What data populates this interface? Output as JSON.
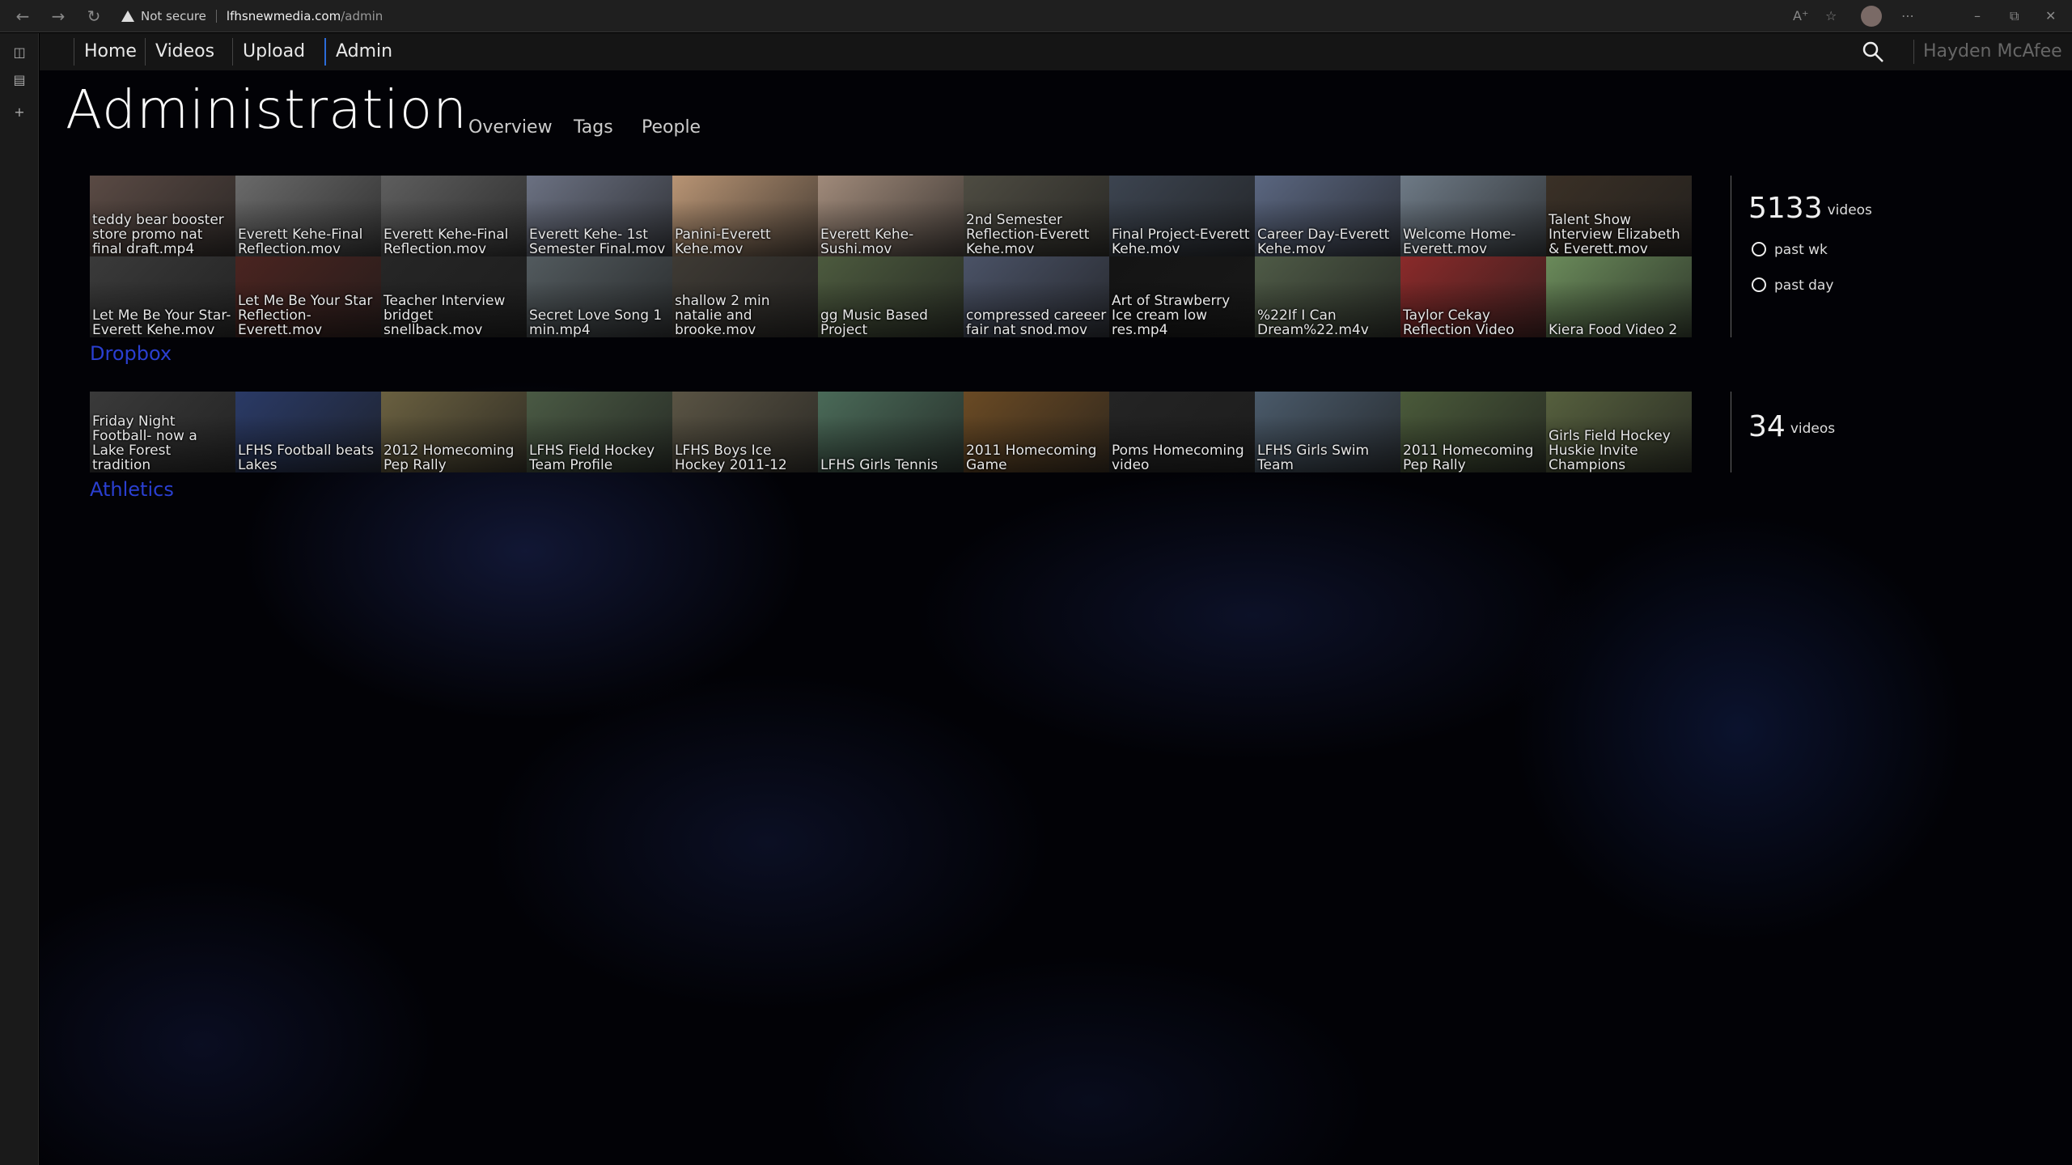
{
  "browser": {
    "security_label": "Not secure",
    "url_host": "lfhsnewmedia.com",
    "url_path": "/admin"
  },
  "nav": {
    "tabs": [
      "Home",
      "Videos",
      "Upload",
      "Admin"
    ],
    "active_tab": "Admin",
    "user_name": "Hayden McAfee"
  },
  "page": {
    "title": "Administration",
    "subtabs": [
      "Overview",
      "Tags",
      "People"
    ]
  },
  "sections": [
    {
      "label": "Dropbox",
      "stats": {
        "count": "5133",
        "unit": "videos",
        "past_week_label": "past wk",
        "past_day_label": "past day"
      },
      "rows": [
        [
          {
            "caption": "teddy bear booster store promo nat final draft.mp4",
            "color": "#5a4a44"
          },
          {
            "caption": "Everett Kehe-Final Reflection.mov",
            "color": "#6a6a6a"
          },
          {
            "caption": "Everett Kehe-Final Reflection.mov",
            "color": "#5e5e5e"
          },
          {
            "caption": "Everett Kehe- 1st Semester Final.mov",
            "color": "#6b7182"
          },
          {
            "caption": "Panini-Everett Kehe.mov",
            "color": "#b89474"
          },
          {
            "caption": "Everett Kehe-Sushi.mov",
            "color": "#a08a7a"
          },
          {
            "caption": "2nd Semester Reflection-Everett Kehe.mov",
            "color": "#4e4c42"
          },
          {
            "caption": "Final Project-Everett Kehe.mov",
            "color": "#3c4450"
          },
          {
            "caption": "Career Day-Everett Kehe.mov",
            "color": "#5a6680"
          },
          {
            "caption": "Welcome Home-Everett.mov",
            "color": "#6e7a86"
          },
          {
            "caption": "Talent Show Interview Elizabeth & Everett.mov",
            "color": "#3a3026"
          }
        ],
        [
          {
            "caption": "Let Me Be Your Star-Everett Kehe.mov",
            "color": "#3a3a3a"
          },
          {
            "caption": "Let Me Be Your Star Reflection-Everett.mov",
            "color": "#4a2420"
          },
          {
            "caption": "Teacher Interview bridget snellback.mov",
            "color": "#262626"
          },
          {
            "caption": "Secret Love Song 1 min.mp4",
            "color": "#525a5e"
          },
          {
            "caption": "shallow 2 min natalie and brooke.mov",
            "color": "#3e3a34"
          },
          {
            "caption": "gg Music Based Project",
            "color": "#4c5a3e"
          },
          {
            "caption": "compressed careeer fair nat snod.mov",
            "color": "#4a5266"
          },
          {
            "caption": "Art of Strawberry Ice cream low res.mp4",
            "color": "#141414"
          },
          {
            "caption": "%22If I Can Dream%22.m4v",
            "color": "#4e5a46"
          },
          {
            "caption": "Taylor Cekay Reflection Video",
            "color": "#8a2a2a"
          },
          {
            "caption": "Kiera Food Video 2",
            "color": "#6a8a5a"
          }
        ]
      ]
    },
    {
      "label": "Athletics",
      "stats": {
        "count": "34",
        "unit": "videos"
      },
      "rows": [
        [
          {
            "caption": "Friday Night Football- now a Lake Forest tradition",
            "color": "#3a3a3a"
          },
          {
            "caption": "LFHS Football beats Lakes",
            "color": "#2a3a66"
          },
          {
            "caption": "2012 Homecoming Pep Rally",
            "color": "#6a6040"
          },
          {
            "caption": "LFHS Field Hockey Team Profile",
            "color": "#4a5a44"
          },
          {
            "caption": "LFHS Boys Ice Hockey 2011-12",
            "color": "#5a5444"
          },
          {
            "caption": "LFHS Girls Tennis",
            "color": "#4a6a58"
          },
          {
            "caption": "2011 Homecoming Game",
            "color": "#6a4a24"
          },
          {
            "caption": "Poms Homecoming video",
            "color": "#242424"
          },
          {
            "caption": "LFHS Girls Swim Team",
            "color": "#4a5a6a"
          },
          {
            "caption": "2011 Homecoming Pep Rally",
            "color": "#4a5a3a"
          },
          {
            "caption": "Girls Field Hockey Huskie Invite Champions",
            "color": "#56603e"
          }
        ]
      ]
    }
  ]
}
